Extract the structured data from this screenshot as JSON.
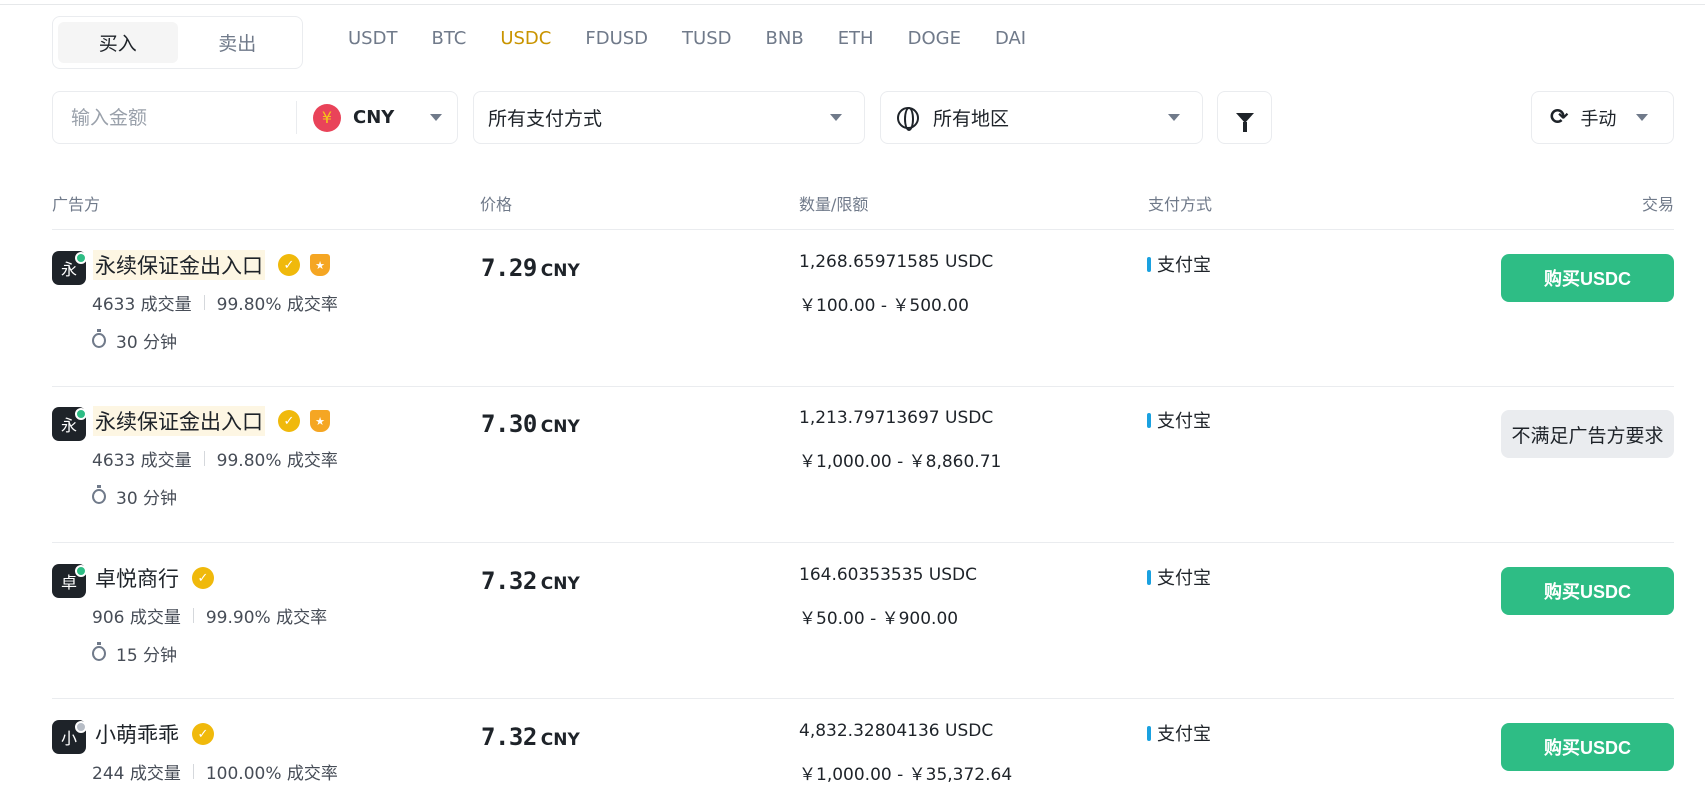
{
  "trade_toggle": {
    "buy": "买入",
    "sell": "卖出"
  },
  "coins": [
    "USDT",
    "BTC",
    "USDC",
    "FDUSD",
    "TUSD",
    "BNB",
    "ETH",
    "DOGE",
    "DAI"
  ],
  "active_coin": "USDC",
  "filters": {
    "amount_placeholder": "输入金额",
    "currency": "CNY",
    "currency_symbol": "¥",
    "payment": "所有支付方式",
    "region": "所有地区",
    "refresh_mode": "手动"
  },
  "table": {
    "headers": {
      "advertiser": "广告方",
      "price": "价格",
      "qty": "数量/限额",
      "payment": "支付方式",
      "trade": "交易"
    },
    "rows": [
      {
        "avatar": "永",
        "name": "永续保证金出入口",
        "orders": "4633 成交量",
        "completion": "99.80% 成交率",
        "time": "30 分钟",
        "price": "7.29",
        "price_cur": "CNY",
        "qty": "1,268.65971585 USDC",
        "limit": "￥100.00 - ￥500.00",
        "payment": "支付宝",
        "action": "购买USDC",
        "online": true
      },
      {
        "avatar": "永",
        "name": "永续保证金出入口",
        "orders": "4633 成交量",
        "completion": "99.80% 成交率",
        "time": "30 分钟",
        "price": "7.30",
        "price_cur": "CNY",
        "qty": "1,213.79713697 USDC",
        "limit": "￥1,000.00 - ￥8,860.71",
        "payment": "支付宝",
        "action": "不满足广告方要求",
        "online": true
      },
      {
        "avatar": "卓",
        "name": "卓悦商行",
        "orders": "906 成交量",
        "completion": "99.90% 成交率",
        "time": "15 分钟",
        "price": "7.32",
        "price_cur": "CNY",
        "qty": "164.60353535 USDC",
        "limit": "￥50.00 - ￥900.00",
        "payment": "支付宝",
        "action": "购买USDC",
        "online": true
      },
      {
        "avatar": "小",
        "name": "小萌乖乖",
        "orders": "244 成交量",
        "completion": "100.00% 成交率",
        "time": "",
        "price": "7.32",
        "price_cur": "CNY",
        "qty": "4,832.32804136 USDC",
        "limit": "￥1,000.00 - ￥35,372.64",
        "payment": "支付宝",
        "action": "购买USDC",
        "online": false
      }
    ]
  },
  "colors": {
    "accent": "#c99400",
    "buy_green": "#2ebd85",
    "online": "#2ebd85",
    "offline": "#b7bdc6",
    "alipay": "#1aa1e0"
  }
}
